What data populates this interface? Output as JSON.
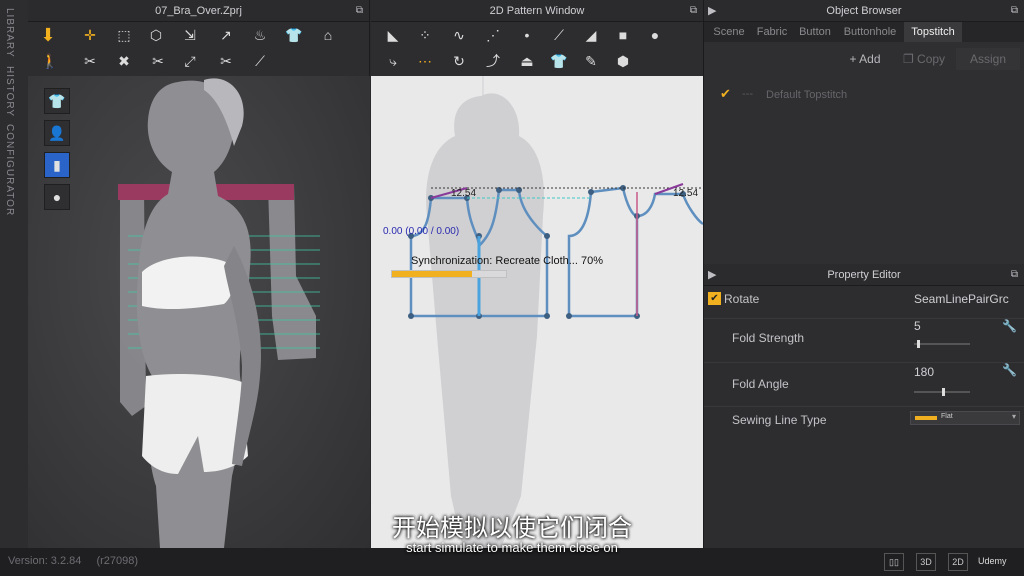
{
  "side_tabs": [
    "LIBRARY",
    "HISTORY",
    "CONFIGURATOR"
  ],
  "window_3d": {
    "title": "07_Bra_Over.Zprj"
  },
  "window_2d": {
    "title": "2D Pattern Window",
    "measure_left": "12.54",
    "measure_right": "12.54",
    "coords": "0.00 (0.00 / 0.00)",
    "sync_text": "Synchronization: Recreate Cloth... 70%",
    "sync_progress": 0.7
  },
  "object_browser": {
    "title": "Object Browser",
    "tabs": [
      "Scene",
      "Fabric",
      "Button",
      "Buttonhole",
      "Topstitch"
    ],
    "active_tab": "Topstitch",
    "add_label": "+ Add",
    "copy_label": "Copy",
    "assign_label": "Assign",
    "item_label": "Default Topstitch"
  },
  "property_editor": {
    "title": "Property Editor",
    "rotate_label": "Rotate",
    "rotate_value": "SeamLinePairGrc",
    "fold_strength_label": "Fold Strength",
    "fold_strength_value": "5",
    "fold_strength_level": 0.05,
    "fold_angle_label": "Fold Angle",
    "fold_angle_value": "180",
    "fold_angle_level": 0.5,
    "sewing_line_type_label": "Sewing Line Type",
    "sewing_line_type_value": "Flat"
  },
  "status": {
    "version": "Version: 3.2.84",
    "build": "(r27098)",
    "btn_3d": "3D",
    "btn_2d": "2D",
    "logo": "Udemy"
  },
  "subtitles": {
    "cn": "开始模拟以使它们闭合",
    "en": "start simulate to make them close on"
  },
  "colors": {
    "accent": "#f0b020",
    "seam_blue": "#4aa3df",
    "pattern_line": "#5a8ab8",
    "topstitch_check": "#f0b020"
  }
}
